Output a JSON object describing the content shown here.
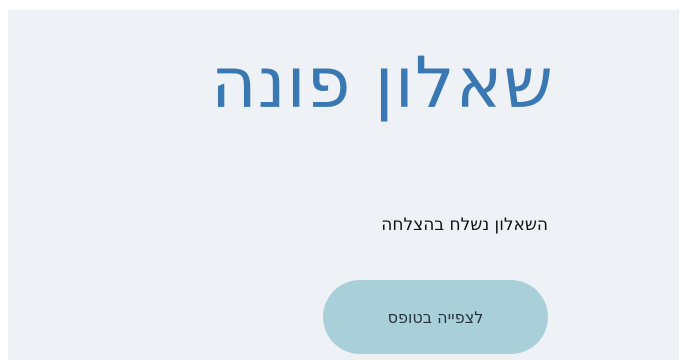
{
  "form": {
    "title": "שאלון פונה",
    "success_message": "השאלון נשלח בהצלחה",
    "view_button_label": "לצפייה בטופס"
  },
  "colors": {
    "card_background": "#eef1f5",
    "title": "#3a78b4",
    "button_background": "#a9d0d9"
  }
}
